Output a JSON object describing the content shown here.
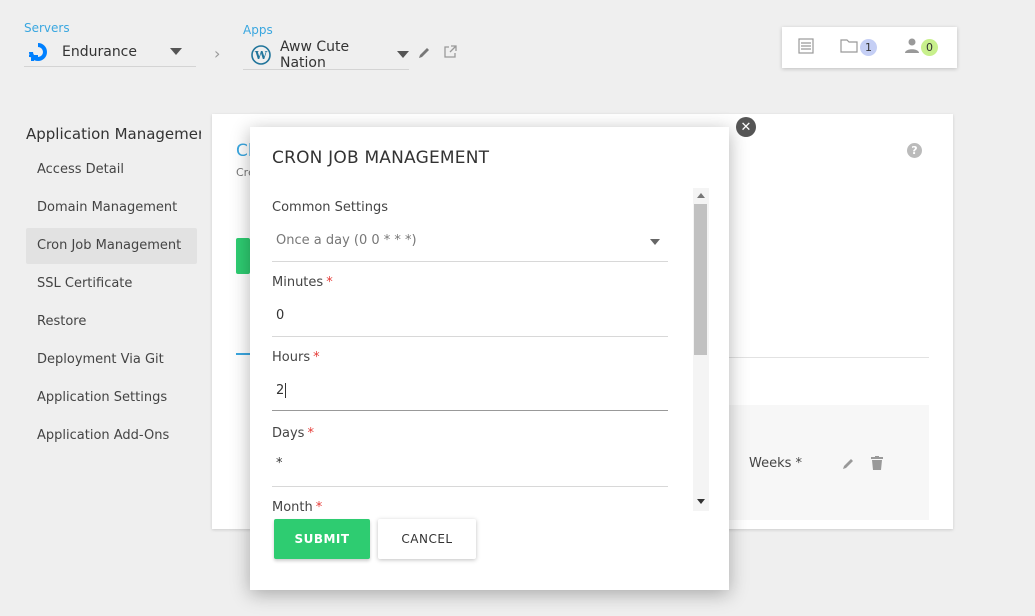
{
  "header": {
    "server_label": "Servers",
    "server_name": "Endurance",
    "apps_label": "Apps",
    "app_name": "Aww Cute Nation",
    "folder_count": "1",
    "user_count": "0"
  },
  "sidebar": {
    "title": "Application Management",
    "items": [
      {
        "label": "Access Detail"
      },
      {
        "label": "Domain Management"
      },
      {
        "label": "Cron Job Management"
      },
      {
        "label": "SSL Certificate"
      },
      {
        "label": "Restore"
      },
      {
        "label": "Deployment Via Git"
      },
      {
        "label": "Application Settings"
      },
      {
        "label": "Application Add-Ons"
      }
    ]
  },
  "background": {
    "heading_partial": "Cl",
    "subtext_partial": "Cre",
    "row_text": "Weeks *"
  },
  "modal": {
    "title": "CRON JOB MANAGEMENT",
    "common_settings_label": "Common Settings",
    "common_settings_value": "Once a day (0 0 * * *)",
    "minutes_label": "Minutes",
    "minutes_value": "0",
    "hours_label": "Hours",
    "hours_value": "2",
    "days_label": "Days",
    "days_value": "*",
    "month_label": "Month",
    "required_mark": "*",
    "submit_label": "SUBMIT",
    "cancel_label": "CANCEL",
    "close_glyph": "✕"
  },
  "colors": {
    "accent_blue": "#3aa7e0",
    "submit_green": "#2ecc71",
    "badge_blue": "#c5cff5",
    "badge_green": "#c8f08c"
  }
}
